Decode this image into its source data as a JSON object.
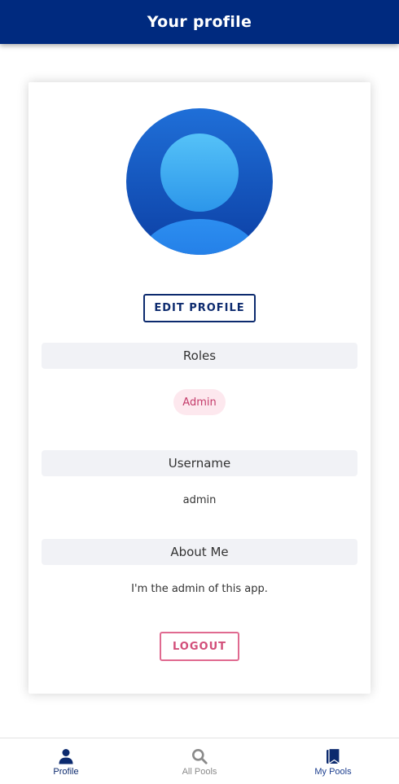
{
  "header": {
    "title": "Your profile"
  },
  "profile": {
    "edit_label": "EDIT PROFILE",
    "roles_heading": "Roles",
    "roles": [
      "Admin"
    ],
    "username_heading": "Username",
    "username": "admin",
    "about_heading": "About Me",
    "about": "I'm the admin of this app.",
    "logout_label": "LOGOUT"
  },
  "bottom_nav": {
    "items": [
      {
        "label": "Profile",
        "icon": "user-icon",
        "active": true
      },
      {
        "label": "All Pools",
        "icon": "search-icon",
        "active": false
      },
      {
        "label": "My Pools",
        "icon": "bookmark-icon",
        "active": false
      }
    ]
  },
  "colors": {
    "header_bg": "#002a7f",
    "primary": "#0c2a6e",
    "accent_pink": "#d24f7a",
    "chip_bg": "#fde8ee",
    "section_bg": "#f1f2f6",
    "nav_active": "#0c2a6e",
    "nav_inactive": "#8a8a8a",
    "nav_mypools": "#1d3f8f"
  }
}
